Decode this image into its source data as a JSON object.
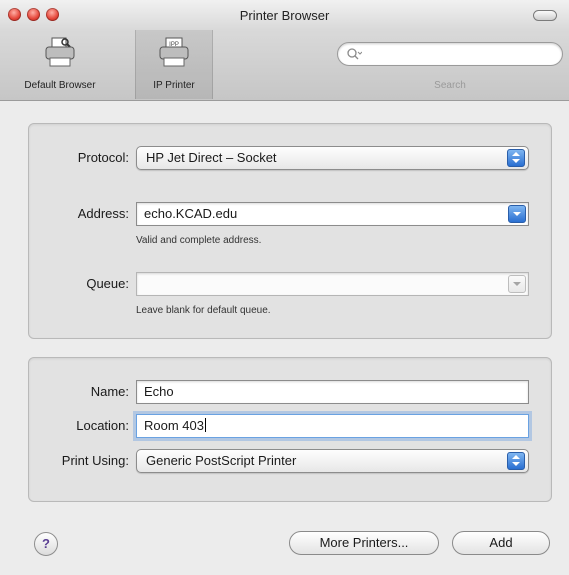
{
  "window": {
    "title": "Printer Browser"
  },
  "toolbar": {
    "items": [
      {
        "label": "Default Browser",
        "icon": "printer-icon"
      },
      {
        "label": "IP Printer",
        "icon": "ip-printer-icon"
      }
    ],
    "search": {
      "label": "Search",
      "placeholder": "",
      "value": ""
    }
  },
  "connection": {
    "protocol": {
      "label": "Protocol:",
      "value": "HP Jet Direct – Socket"
    },
    "address": {
      "label": "Address:",
      "value": "echo.KCAD.edu",
      "note": "Valid and complete address."
    },
    "queue": {
      "label": "Queue:",
      "value": "",
      "note": "Leave blank for default queue."
    }
  },
  "details": {
    "name": {
      "label": "Name:",
      "value": "Echo"
    },
    "location": {
      "label": "Location:",
      "value": "Room 403"
    },
    "print_using": {
      "label": "Print Using:",
      "value": "Generic PostScript Printer"
    }
  },
  "footer": {
    "help": "?",
    "more_printers": "More Printers...",
    "add": "Add"
  }
}
